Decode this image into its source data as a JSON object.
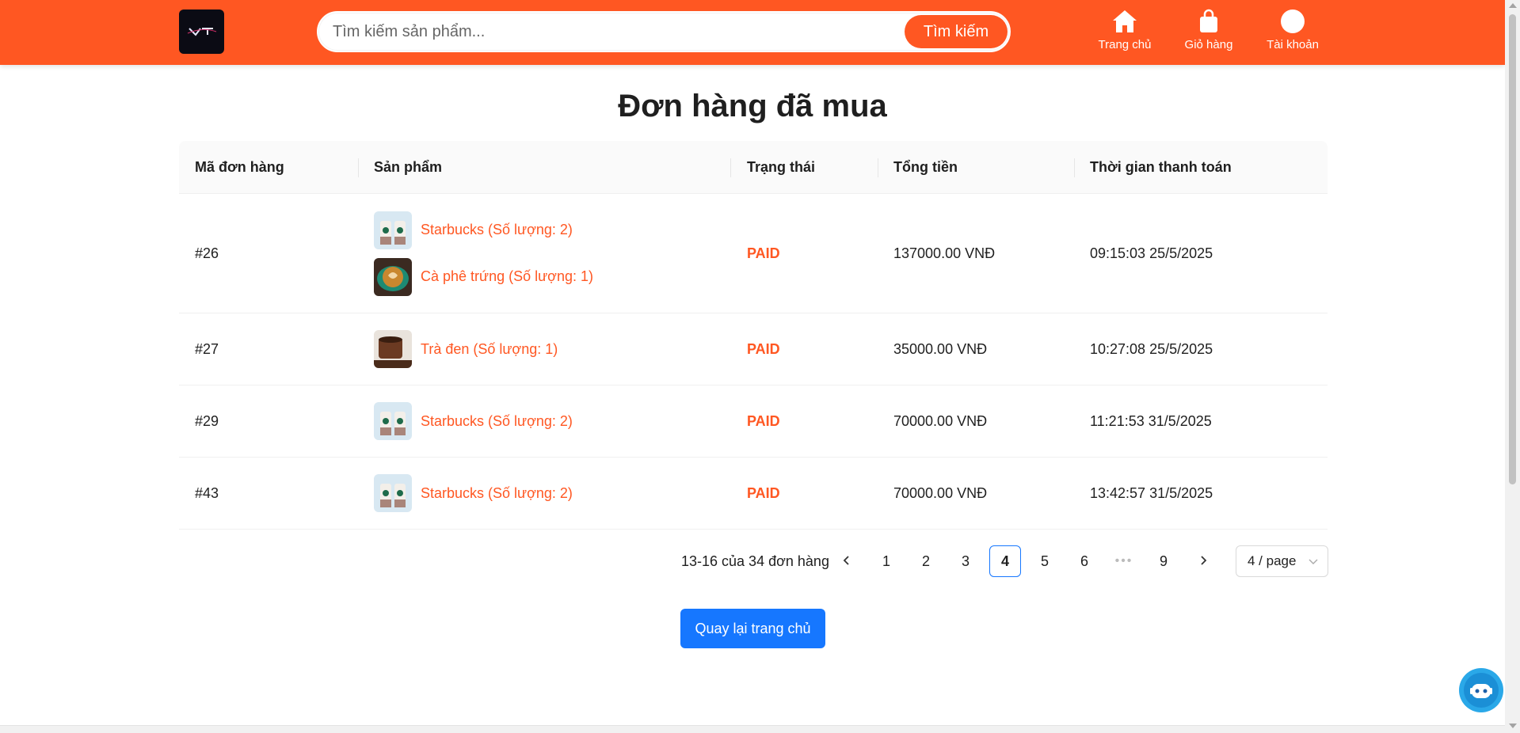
{
  "header": {
    "search": {
      "placeholder": "Tìm kiếm sản phẩm...",
      "button_label": "Tìm kiếm"
    },
    "nav": [
      {
        "label": "Trang chủ",
        "icon": "home-icon"
      },
      {
        "label": "Giỏ hàng",
        "icon": "shopping-bag-icon"
      },
      {
        "label": "Tài khoản",
        "icon": "user-circle-icon"
      }
    ]
  },
  "page": {
    "title": "Đơn hàng đã mua"
  },
  "table": {
    "columns": [
      "Mã đơn hàng",
      "Sản phẩm",
      "Trạng thái",
      "Tổng tiền",
      "Thời gian thanh toán"
    ],
    "rows": [
      {
        "id": "#26",
        "products": [
          {
            "label": "Starbucks (Số lượng: 2)",
            "image": "starbucks-cups"
          },
          {
            "label": "Cà phê trứng (Số lượng: 1)",
            "image": "latte-art"
          }
        ],
        "status": "PAID",
        "total": "137000.00 VNĐ",
        "paid_at": "09:15:03 25/5/2025"
      },
      {
        "id": "#27",
        "products": [
          {
            "label": "Trà đen (Số lượng: 1)",
            "image": "black-tea"
          }
        ],
        "status": "PAID",
        "total": "35000.00 VNĐ",
        "paid_at": "10:27:08 25/5/2025"
      },
      {
        "id": "#29",
        "products": [
          {
            "label": "Starbucks (Số lượng: 2)",
            "image": "starbucks-cups"
          }
        ],
        "status": "PAID",
        "total": "70000.00 VNĐ",
        "paid_at": "11:21:53 31/5/2025"
      },
      {
        "id": "#43",
        "products": [
          {
            "label": "Starbucks (Số lượng: 2)",
            "image": "starbucks-cups"
          }
        ],
        "status": "PAID",
        "total": "70000.00 VNĐ",
        "paid_at": "13:42:57 31/5/2025"
      }
    ]
  },
  "pagination": {
    "total_text": "13-16 của 34 đơn hàng",
    "pages": [
      "1",
      "2",
      "3",
      "4",
      "5",
      "6",
      "9"
    ],
    "current": "4",
    "ellipsis": "•••",
    "page_size": "4 / page"
  },
  "actions": {
    "back_label": "Quay lại trang chủ"
  },
  "colors": {
    "brand": "#ff5722",
    "primary": "#1677ff",
    "status_paid": "#ff5722"
  }
}
